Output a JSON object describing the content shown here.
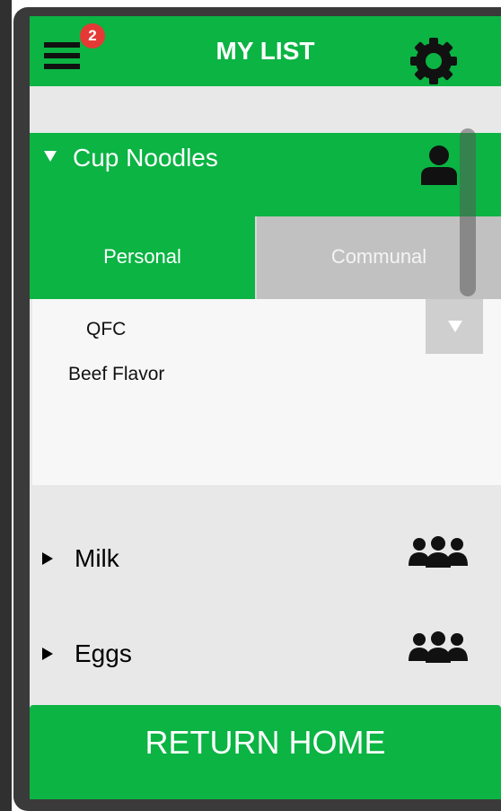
{
  "header": {
    "title": "MY LIST",
    "notification_count": "2"
  },
  "open_item": {
    "name": "Cup Noodles",
    "tabs": [
      {
        "label": "Personal",
        "active": true
      },
      {
        "label": "Communal",
        "active": false
      }
    ],
    "store": "QFC",
    "note": "Beef Flavor"
  },
  "items": [
    {
      "name": "Milk",
      "type": "communal"
    },
    {
      "name": "Eggs",
      "type": "communal"
    }
  ],
  "footer": {
    "return_label": "RETURN HOME"
  },
  "colors": {
    "accent": "#0bb443",
    "badge": "#e53935",
    "inactive_tab": "#c1c1c1"
  },
  "icons": [
    "menu-icon",
    "gear-icon",
    "person-icon",
    "group-icon",
    "chevron-down-icon",
    "triangle-right-icon"
  ]
}
